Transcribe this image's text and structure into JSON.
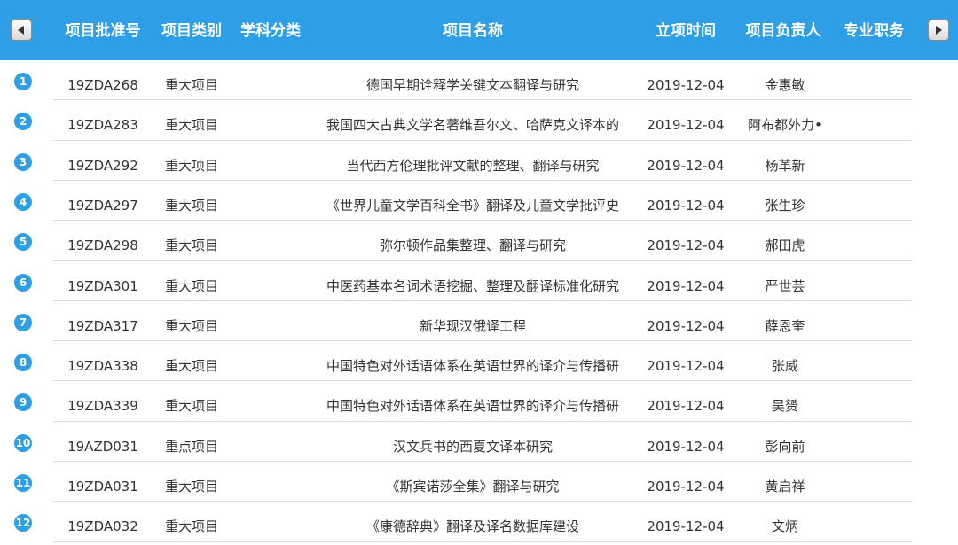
{
  "header": {
    "columns": [
      "项目批准号",
      "项目类别",
      "学科分类",
      "项目名称",
      "立项时间",
      "项目负责人",
      "专业职务"
    ],
    "prev_icon": "arrow-left-icon",
    "next_icon": "arrow-right-icon"
  },
  "rows": [
    {
      "index": "1",
      "id": "19ZDA268",
      "category": "重大项目",
      "name": "德国早期诠释学关键文本翻译与研究",
      "date": "2019-12-04",
      "leader": "金惠敏"
    },
    {
      "index": "2",
      "id": "19ZDA283",
      "category": "重大项目",
      "name": "我国四大古典文学名著维吾尔文、哈萨克文译本的",
      "date": "2019-12-04",
      "leader": "阿布都外力•"
    },
    {
      "index": "3",
      "id": "19ZDA292",
      "category": "重大项目",
      "name": "当代西方伦理批评文献的整理、翻译与研究",
      "date": "2019-12-04",
      "leader": "杨革新"
    },
    {
      "index": "4",
      "id": "19ZDA297",
      "category": "重大项目",
      "name": "《世界儿童文学百科全书》翻译及儿童文学批评史",
      "date": "2019-12-04",
      "leader": "张生珍"
    },
    {
      "index": "5",
      "id": "19ZDA298",
      "category": "重大项目",
      "name": "弥尔顿作品集整理、翻译与研究",
      "date": "2019-12-04",
      "leader": "郝田虎"
    },
    {
      "index": "6",
      "id": "19ZDA301",
      "category": "重大项目",
      "name": "中医药基本名词术语挖掘、整理及翻译标准化研究",
      "date": "2019-12-04",
      "leader": "严世芸"
    },
    {
      "index": "7",
      "id": "19ZDA317",
      "category": "重大项目",
      "name": "新华现汉俄译工程",
      "date": "2019-12-04",
      "leader": "薛恩奎"
    },
    {
      "index": "8",
      "id": "19ZDA338",
      "category": "重大项目",
      "name": "中国特色对外话语体系在英语世界的译介与传播研",
      "date": "2019-12-04",
      "leader": "张威"
    },
    {
      "index": "9",
      "id": "19ZDA339",
      "category": "重大项目",
      "name": "中国特色对外话语体系在英语世界的译介与传播研",
      "date": "2019-12-04",
      "leader": "吴赟"
    },
    {
      "index": "10",
      "id": "19AZD031",
      "category": "重点项目",
      "name": "汉文兵书的西夏文译本研究",
      "date": "2019-12-04",
      "leader": "彭向前"
    },
    {
      "index": "11",
      "id": "19ZDA031",
      "category": "重大项目",
      "name": "《斯宾诺莎全集》翻译与研究",
      "date": "2019-12-04",
      "leader": "黄启祥"
    },
    {
      "index": "12",
      "id": "19ZDA032",
      "category": "重大项目",
      "name": "《康德辞典》翻译及译名数据库建设",
      "date": "2019-12-04",
      "leader": "文炳"
    }
  ]
}
